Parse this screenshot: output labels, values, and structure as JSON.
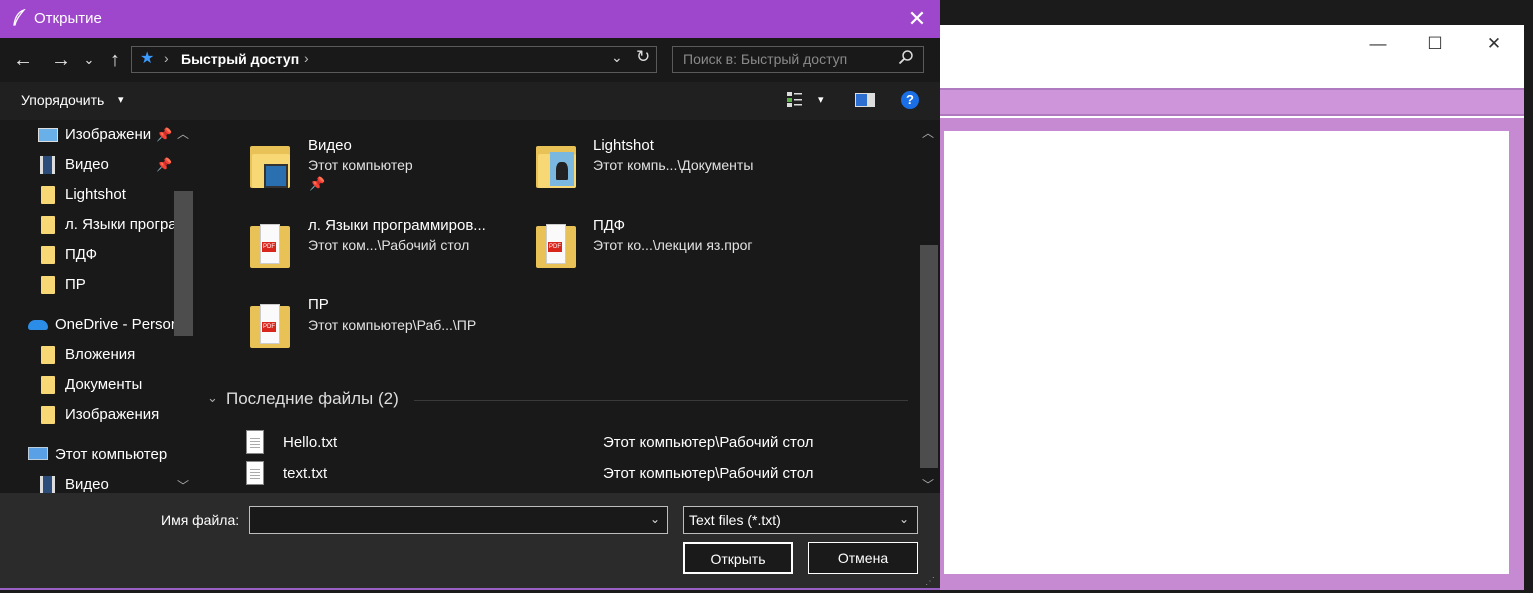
{
  "dialog": {
    "title": "Открытие",
    "close_glyph": "✕"
  },
  "nav": {
    "back": "←",
    "forward": "→",
    "recent": "⌄",
    "up": "↑"
  },
  "address": {
    "location": "Быстрый доступ",
    "separator": "›",
    "dropdown": "⌄",
    "refresh": "↻"
  },
  "search": {
    "placeholder": "Поиск в: Быстрый доступ",
    "icon": "search-icon"
  },
  "command_bar": {
    "organize_label": "Упорядочить",
    "organize_arrow": "▾",
    "view_arrow": "▾",
    "help_glyph": "?"
  },
  "sidebar": {
    "items": [
      {
        "label": "Изображени",
        "icon": "pictures-icon",
        "pinned": true
      },
      {
        "label": "Видео",
        "icon": "video-icon",
        "pinned": true
      },
      {
        "label": "Lightshot",
        "icon": "folder-icon",
        "pinned": false
      },
      {
        "label": "л. Языки програ",
        "icon": "folder-icon",
        "pinned": false
      },
      {
        "label": "ПДФ",
        "icon": "folder-icon",
        "pinned": false
      },
      {
        "label": "ПР",
        "icon": "folder-icon",
        "pinned": false
      },
      {
        "label": "OneDrive - Persor",
        "icon": "onedrive-icon",
        "pinned": false
      },
      {
        "label": "Вложения",
        "icon": "folder-icon",
        "pinned": false
      },
      {
        "label": "Документы",
        "icon": "folder-icon",
        "pinned": false
      },
      {
        "label": "Изображения",
        "icon": "folder-icon",
        "pinned": false
      },
      {
        "label": "Этот компьютер",
        "icon": "computer-icon",
        "pinned": false
      },
      {
        "label": "Видео",
        "icon": "video-icon",
        "pinned": false
      }
    ],
    "pin_glyph": "📌"
  },
  "quick_access": [
    {
      "name": "Видео",
      "path": "Этот компьютер",
      "pinned": true,
      "icon": "video-folder-icon"
    },
    {
      "name": "Lightshot",
      "path": "Этот компь...\\Документы",
      "pinned": false,
      "icon": "lightshot-folder-icon"
    },
    {
      "name": "л. Языки программиров...",
      "path": "Этот ком...\\Рабочий стол",
      "pinned": false,
      "icon": "pdf-folder-icon"
    },
    {
      "name": "ПДФ",
      "path": "Этот ко...\\лекции яз.прог",
      "pinned": false,
      "icon": "pdf-folder-icon"
    },
    {
      "name": "ПР",
      "path": "Этот компьютер\\Раб...\\ПР",
      "pinned": false,
      "icon": "pdf-folder-icon"
    }
  ],
  "recent": {
    "header": "Последние файлы (2)",
    "chevron": "⌄",
    "files": [
      {
        "name": "Hello.txt",
        "path": "Этот компьютер\\Рабочий стол"
      },
      {
        "name": "text.txt",
        "path": "Этот компьютер\\Рабочий стол"
      }
    ]
  },
  "bottom": {
    "filename_label": "Имя файла:",
    "filename_value": "",
    "filter_value": "Text files (*.txt)",
    "open_label": "Открыть",
    "cancel_label": "Отмена",
    "drop_glyph": "⌄"
  },
  "background_window": {
    "minimize": "—",
    "maximize": "☐",
    "close": "✕"
  },
  "colors": {
    "title_bar": "#9e47cd",
    "background_accent": "#c58ad2"
  }
}
